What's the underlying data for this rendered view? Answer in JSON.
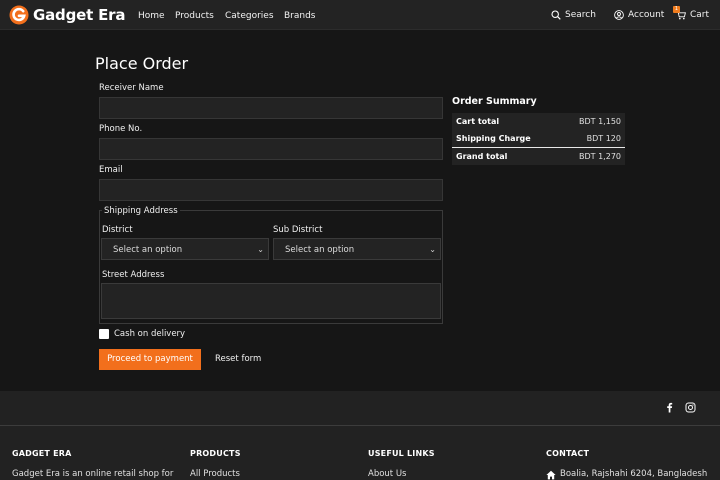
{
  "header": {
    "brand": "Gadget Era",
    "nav": [
      "Home",
      "Products",
      "Categories",
      "Brands"
    ],
    "search_label": "Search",
    "account_label": "Account",
    "cart_label": "Cart",
    "cart_count": "1",
    "accent_color": "#f26f1c"
  },
  "form": {
    "title": "Place Order",
    "receiver_label": "Receiver Name",
    "receiver_value": "",
    "phone_label": "Phone No.",
    "phone_value": "",
    "email_label": "Email",
    "email_value": "",
    "shipping_legend": "Shipping Address",
    "district_label": "District",
    "district_value": "Select an option",
    "subdistrict_label": "Sub District",
    "subdistrict_value": "Select an option",
    "street_label": "Street Address",
    "street_value": "",
    "cod_label": "Cash on delivery",
    "cod_checked": false,
    "proceed_label": "Proceed to payment",
    "reset_label": "Reset form"
  },
  "summary": {
    "title": "Order Summary",
    "rows": [
      {
        "label": "Cart total",
        "value": "BDT 1,150"
      },
      {
        "label": "Shipping Charge",
        "value": "BDT 120"
      },
      {
        "label": "Grand total",
        "value": "BDT 1,270"
      }
    ]
  },
  "footer": {
    "social": [
      "facebook-icon",
      "instagram-icon"
    ],
    "columns": [
      {
        "heading": "GADGET ERA",
        "text": "Gadget Era is an online retail shop for"
      },
      {
        "heading": "PRODUCTS",
        "text": "All Products"
      },
      {
        "heading": "USEFUL LINKS",
        "text": "About Us"
      },
      {
        "heading": "CONTACT",
        "text": "Boalia, Rajshahi 6204, Bangladesh"
      }
    ]
  }
}
